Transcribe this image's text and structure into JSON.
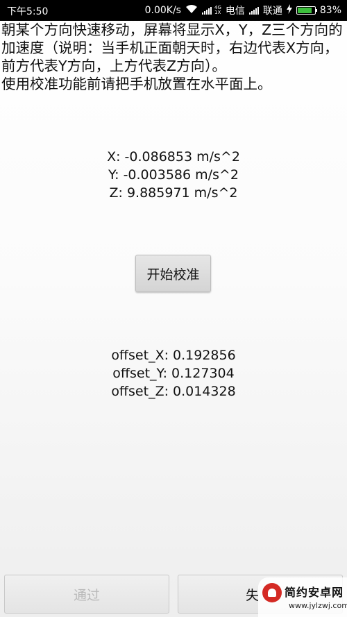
{
  "status_bar": {
    "time": "下午5:50",
    "network_speed": "0.00K/s",
    "carrier_1": "电信",
    "carrier_2": "联通",
    "battery": "83%",
    "network_tag_top": "4G",
    "network_tag_bottom": "1X",
    "battery_level": 0.83,
    "icons": [
      "wifi-icon",
      "signal-icon",
      "charging-icon",
      "battery-icon"
    ]
  },
  "instruction": {
    "text": "朝某个方向快速移动，屏幕将显示X，Y，Z三个方向的加速度（说明：当手机正面朝天时，右边代表X方向，前方代表Y方向，上方代表Z方向）。\n使用校准功能前请把手机放置在水平面上。"
  },
  "readings": {
    "x": "X: -0.086853 m/s^2",
    "y": "Y: -0.003586 m/s^2",
    "z": "Z: 9.885971 m/s^2"
  },
  "calibrate_button": {
    "label": "开始校准"
  },
  "offsets": {
    "x": "offset_X: 0.192856",
    "y": "offset_Y: 0.127304",
    "z": "offset_Z: 0.014328"
  },
  "bottom_bar": {
    "pass_label": "通过",
    "fail_label": "失"
  },
  "watermark": {
    "title": "简约安卓网",
    "url": "www.jylzwj.com"
  },
  "colors": {
    "status_bar_bg": "#000000",
    "battery_green": "#3dbf3d",
    "disabled_text": "#b9b9b9",
    "watermark_red": "#d42a24"
  }
}
